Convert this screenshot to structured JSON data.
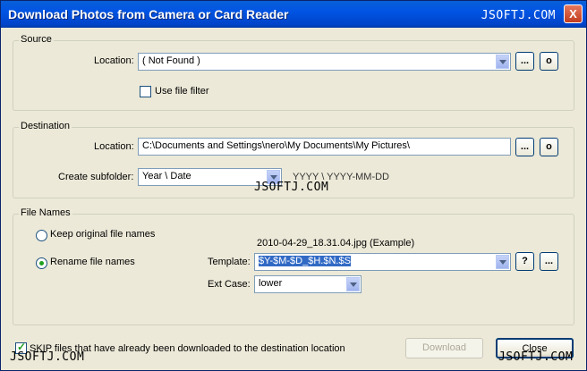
{
  "window": {
    "title": "Download Photos from Camera or Card Reader",
    "close_glyph": "X"
  },
  "watermark": "JSOFTJ.COM",
  "source": {
    "group_label": "Source",
    "location_label": "Location:",
    "location_value": "( Not Found )",
    "browse_label": "...",
    "open_label": "o",
    "use_file_filter_label": "Use file filter",
    "use_file_filter_checked": false
  },
  "destination": {
    "group_label": "Destination",
    "location_label": "Location:",
    "location_value": "C:\\Documents and Settings\\nero\\My Documents\\My Pictures\\",
    "browse_label": "...",
    "open_label": "o",
    "subfolder_label": "Create subfolder:",
    "subfolder_value": "Year \\ Date",
    "subfolder_hint": "YYYY \\ YYYY-MM-DD"
  },
  "file_names": {
    "group_label": "File Names",
    "keep_label": "Keep original file names",
    "keep_selected": false,
    "rename_label": "Rename file names",
    "rename_selected": true,
    "example": "2010-04-29_18.31.04.jpg   (Example)",
    "template_label": "Template:",
    "template_value": "$Y-$M-$D_$H.$N.$S",
    "help_label": "?",
    "more_label": "...",
    "extcase_label": "Ext Case:",
    "extcase_value": "lower"
  },
  "footer": {
    "skip_label": "SKIP files that have already been downloaded to the destination location",
    "skip_checked": true,
    "download_label": "Download",
    "close_label": "Close"
  },
  "colors": {
    "titlebar": "#0054e3",
    "window_bg": "#ece9d8",
    "field_border": "#7f9db9",
    "selection": "#316ac5"
  }
}
